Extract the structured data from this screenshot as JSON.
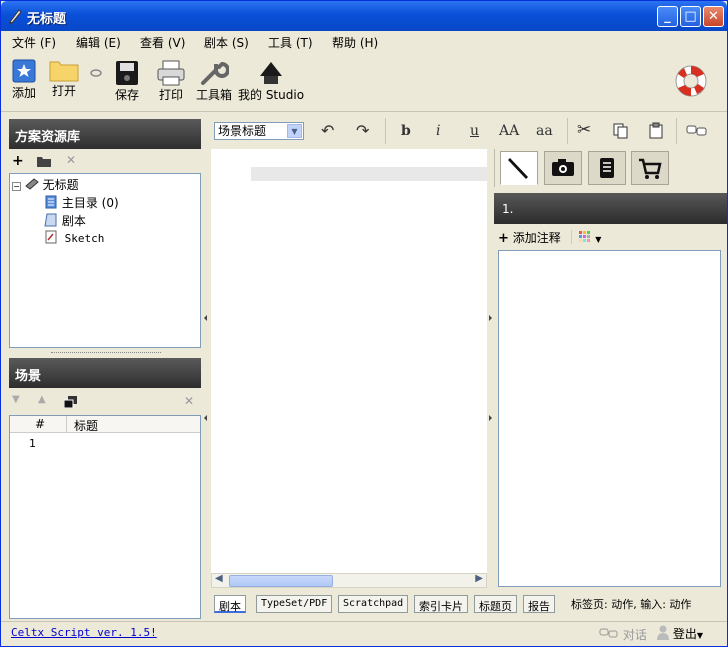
{
  "window": {
    "title": "无标题",
    "min": "_",
    "max": "□",
    "close": "✕"
  },
  "menu": [
    "文件 (F)",
    "编辑 (E)",
    "查看 (V)",
    "剧本 (S)",
    "工具 (T)",
    "帮助 (H)"
  ],
  "toolbar": {
    "add": "添加",
    "open": "打开",
    "save": "保存",
    "print": "打印",
    "toolbox": "工具箱",
    "studio": "我的 Studio"
  },
  "library": {
    "title": "方案资源库",
    "tree": {
      "root": "无标题",
      "items": [
        "主目录 (0)",
        "剧本",
        "Sketch"
      ]
    }
  },
  "scenes": {
    "title": "场景",
    "columns": [
      "#",
      "标题"
    ],
    "rows": [
      {
        "num": "1",
        "title": ""
      }
    ]
  },
  "editor": {
    "style_select": "场景标题",
    "format_buttons": [
      "b",
      "i",
      "u",
      "AA",
      "aa"
    ]
  },
  "tabs": [
    "剧本",
    "TypeSet/PDF",
    "Scratchpad",
    "索引卡片",
    "标题页",
    "报告"
  ],
  "status_info": "标签页: 动作, 输入: 动作",
  "sidebar": {
    "note_head": "1.",
    "add_note": "添加注释"
  },
  "statusbar": {
    "version": "Celtx Script ver. 1.5!",
    "chat": "对话",
    "logout": "登出"
  },
  "colors": {
    "titlebar": "#0a50d8",
    "panel_header": "#3a3a3a",
    "window_bg": "#ece9d8"
  }
}
